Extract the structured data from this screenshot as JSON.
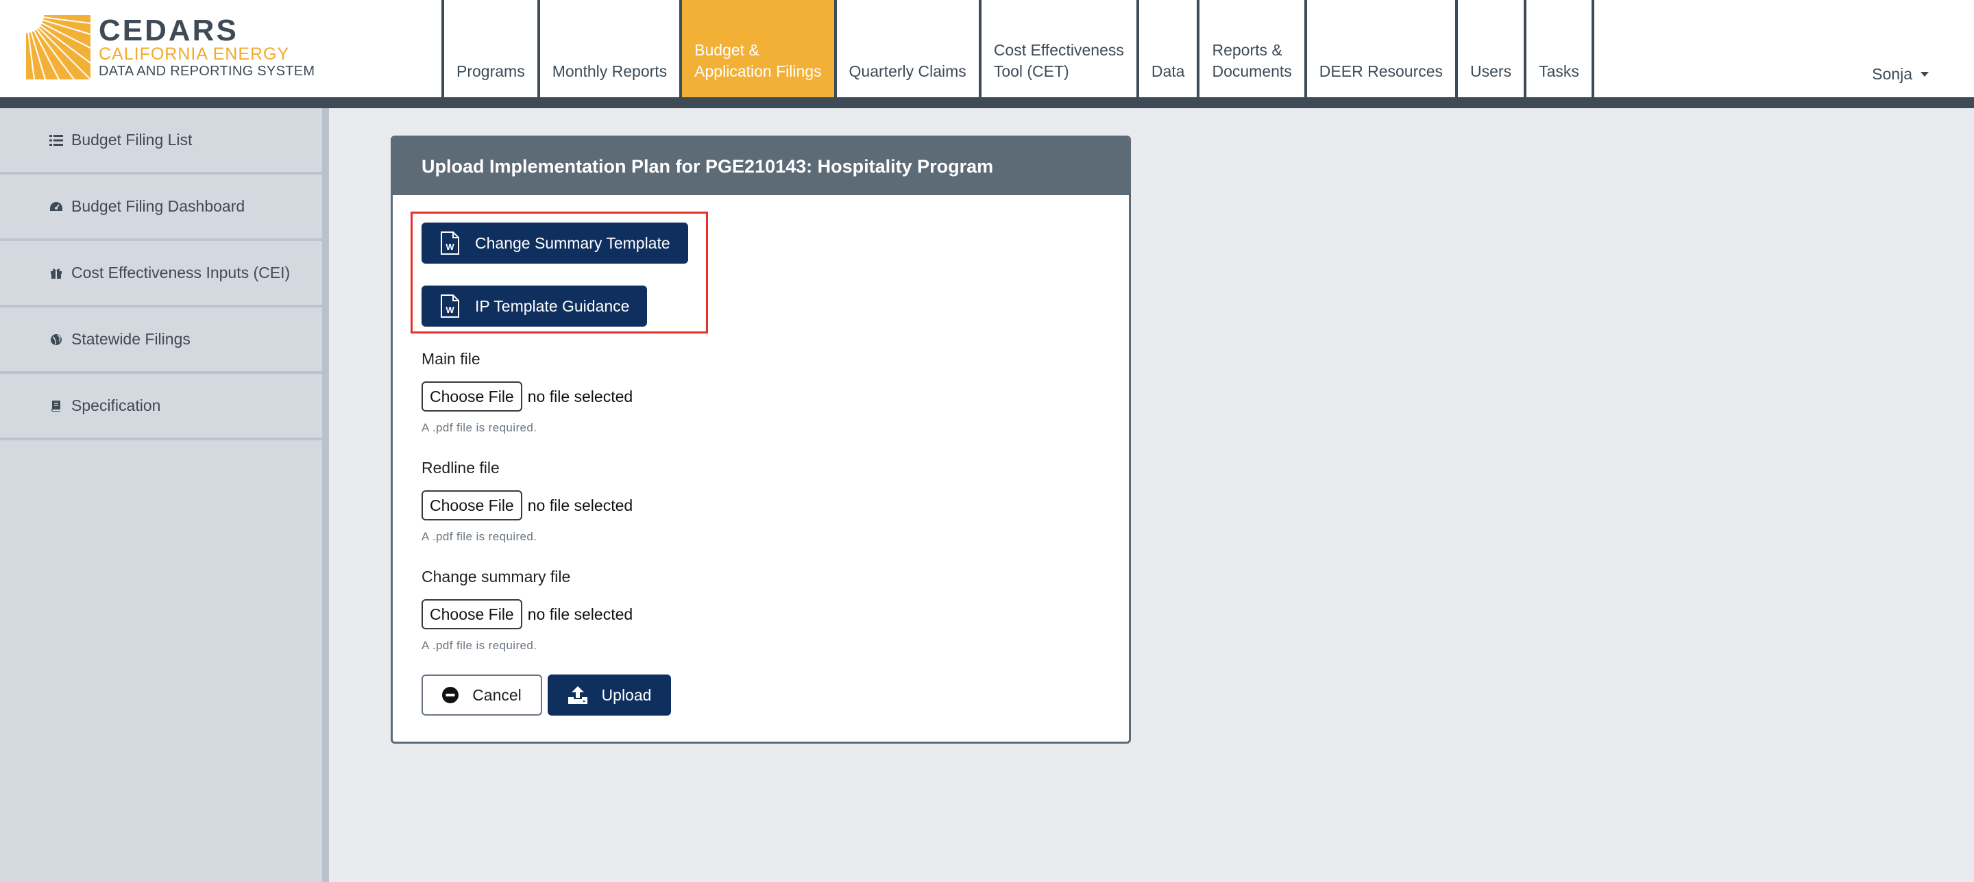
{
  "logo": {
    "title": "CEDARS",
    "subtitle1": "CALIFORNIA ENERGY",
    "subtitle2": "DATA AND REPORTING SYSTEM"
  },
  "nav": {
    "programs": "Programs",
    "monthly_reports": "Monthly Reports",
    "budget_line1": "Budget &",
    "budget_line2": "Application Filings",
    "quarterly_claims": "Quarterly Claims",
    "cet_line1": "Cost Effectiveness",
    "cet_line2": "Tool (CET)",
    "data": "Data",
    "reports_line1": "Reports &",
    "reports_line2": "Documents",
    "deer": "DEER Resources",
    "users": "Users",
    "tasks": "Tasks",
    "active": "Budget & Application Filings"
  },
  "user": {
    "name": "Sonja"
  },
  "sidebar": {
    "items": [
      {
        "label": "Budget Filing List",
        "icon": "list-icon"
      },
      {
        "label": "Budget Filing Dashboard",
        "icon": "dashboard-icon"
      },
      {
        "label": "Cost Effectiveness Inputs (CEI)",
        "icon": "gift-icon"
      },
      {
        "label": "Statewide Filings",
        "icon": "globe-icon"
      },
      {
        "label": "Specification",
        "icon": "book-icon"
      }
    ]
  },
  "card": {
    "title": "Upload Implementation Plan for PGE210143: Hospitality Program",
    "template_buttons": {
      "change_summary": "Change Summary Template",
      "ip_guidance": "IP Template Guidance"
    },
    "fields": [
      {
        "label": "Main file",
        "button": "Choose File",
        "status": "no file selected",
        "help": "A .pdf file is required."
      },
      {
        "label": "Redline file",
        "button": "Choose File",
        "status": "no file selected",
        "help": "A .pdf file is required."
      },
      {
        "label": "Change summary file",
        "button": "Choose File",
        "status": "no file selected",
        "help": "A .pdf file is required."
      }
    ],
    "cancel_label": "Cancel",
    "upload_label": "Upload"
  },
  "colors": {
    "nav_dark": "#3e4a55",
    "nav_active": "#f3b037",
    "primary_button": "#0f2f5e",
    "highlight": "#e3302b",
    "card_header": "#5d6b77"
  }
}
